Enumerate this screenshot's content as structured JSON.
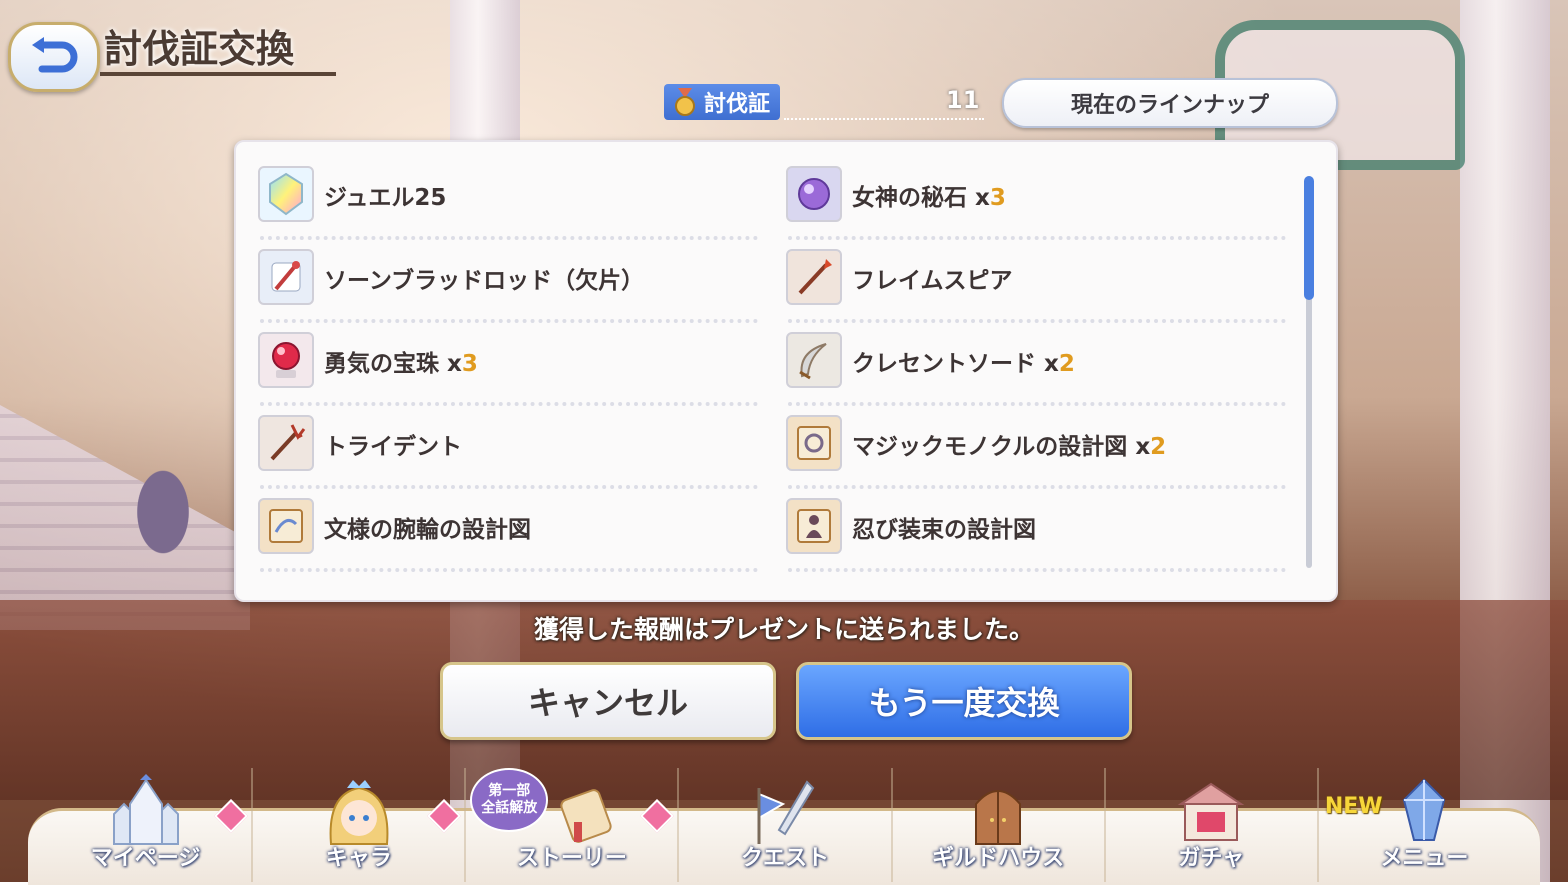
{
  "header": {
    "title": "討伐証交換",
    "back_icon": "back-arrow-icon"
  },
  "currency": {
    "name": "討伐証",
    "count": "11"
  },
  "lineup_button": "現在のラインナップ",
  "rewards": [
    {
      "name": "ジュエル25",
      "mult": "",
      "qty": "",
      "icon": "jewel-icon"
    },
    {
      "name": "女神の秘石",
      "mult": "x",
      "qty": "3",
      "icon": "goddess-stone-icon"
    },
    {
      "name": "ソーンブラッドロッド（欠片）",
      "mult": "",
      "qty": "",
      "icon": "rod-fragment-icon"
    },
    {
      "name": "フレイムスピア",
      "mult": "",
      "qty": "",
      "icon": "spear-icon"
    },
    {
      "name": "勇気の宝珠",
      "mult": "x",
      "qty": "3",
      "icon": "orb-icon"
    },
    {
      "name": "クレセントソード",
      "mult": "x",
      "qty": "2",
      "icon": "sword-icon"
    },
    {
      "name": "トライデント",
      "mult": "",
      "qty": "",
      "icon": "trident-icon"
    },
    {
      "name": "マジックモノクルの設計図",
      "mult": "x",
      "qty": "2",
      "icon": "blueprint-icon"
    },
    {
      "name": "文様の腕輪の設計図",
      "mult": "",
      "qty": "",
      "icon": "blueprint-icon"
    },
    {
      "name": "忍び装束の設計図",
      "mult": "",
      "qty": "",
      "icon": "blueprint-icon"
    }
  ],
  "message": "獲得した報酬はプレゼントに送られました。",
  "buttons": {
    "cancel": "キャンセル",
    "again": "もう一度交換"
  },
  "nav": [
    {
      "label": "マイページ",
      "icon": "castle-icon",
      "notif": true
    },
    {
      "label": "キャラ",
      "icon": "character-icon",
      "notif": true
    },
    {
      "label": "ストーリー",
      "icon": "scroll-icon",
      "notif": true,
      "badge": [
        "第一部",
        "全話解放"
      ]
    },
    {
      "label": "クエスト",
      "icon": "flag-sword-icon",
      "notif": false
    },
    {
      "label": "ギルドハウス",
      "icon": "door-icon",
      "notif": false
    },
    {
      "label": "ガチャ",
      "icon": "gacha-icon",
      "notif": false
    },
    {
      "label": "メニュー",
      "icon": "crystal-icon",
      "notif": false,
      "new": "NEW"
    }
  ],
  "colors": {
    "accent_blue": "#3f7be6",
    "qty_orange": "#e09b1f",
    "notif_pink": "#f06fa0"
  }
}
